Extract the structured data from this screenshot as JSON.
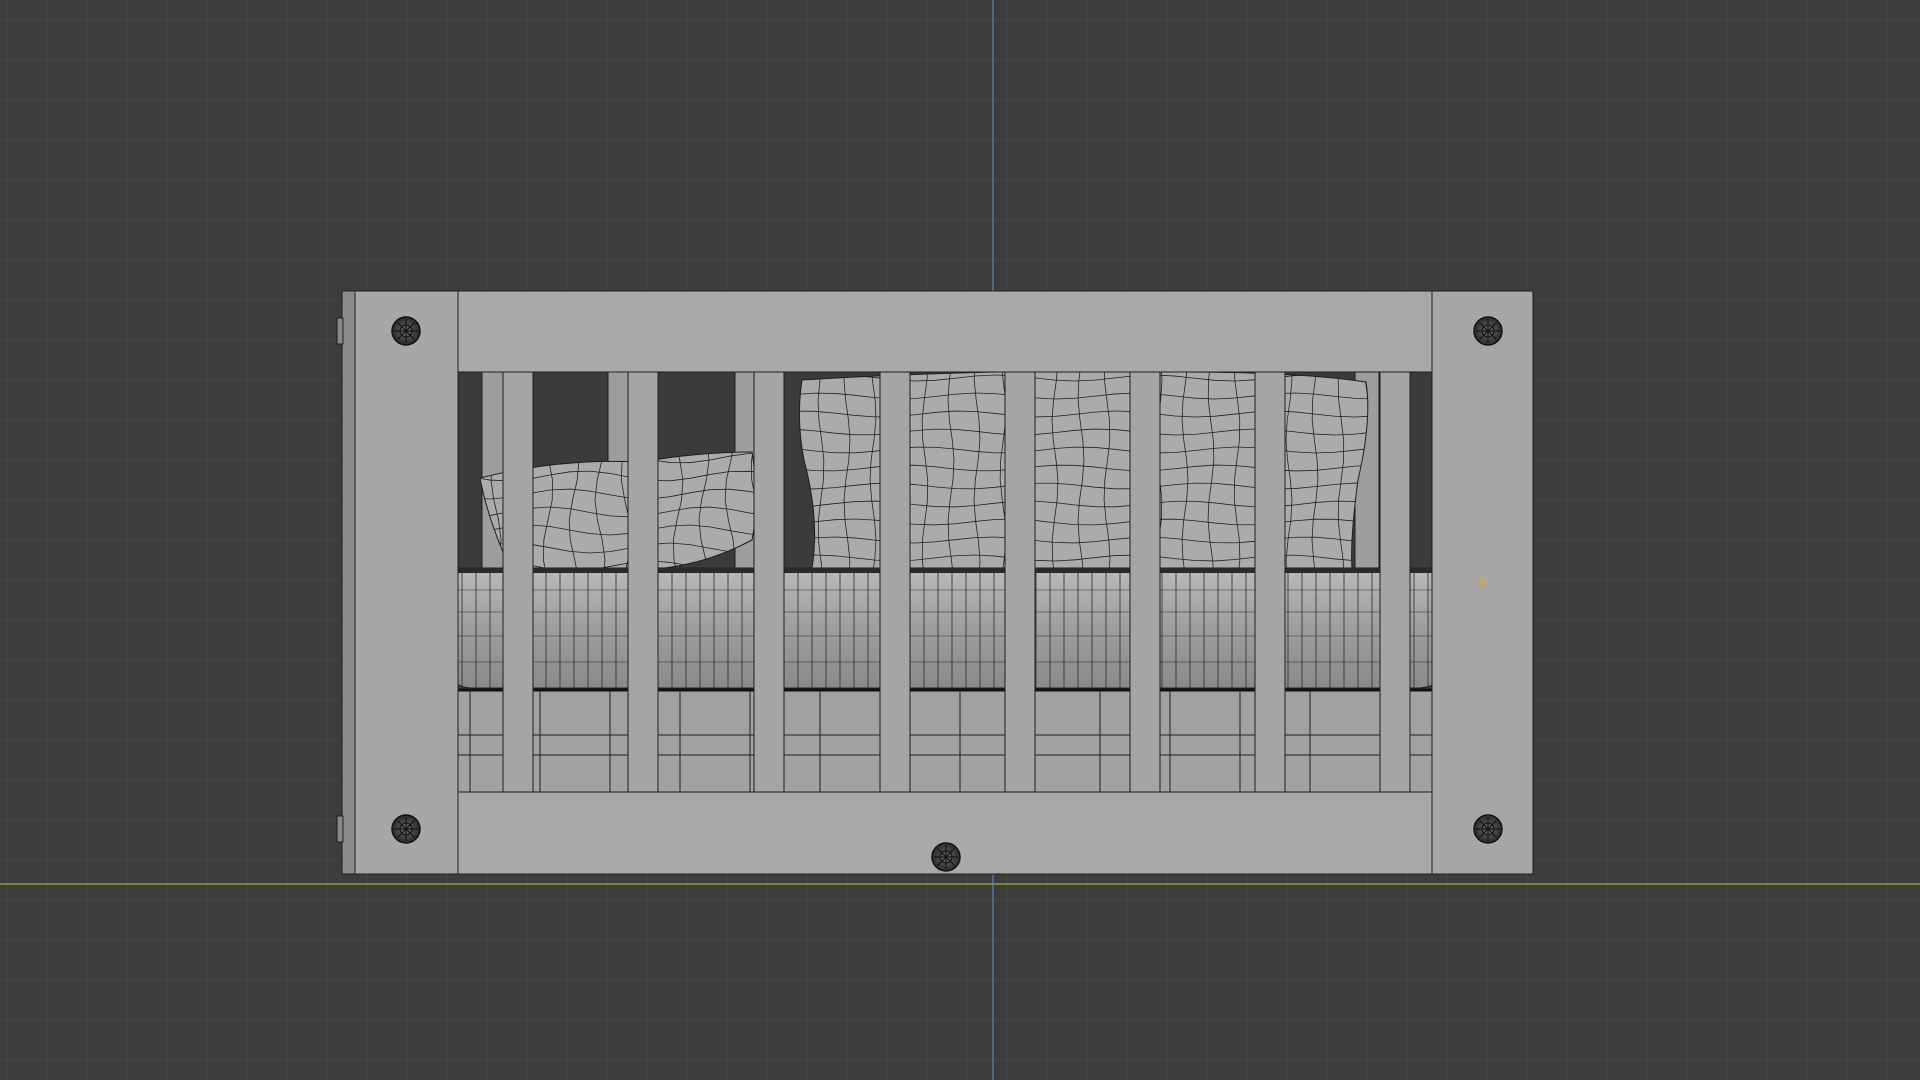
{
  "viewport": {
    "view": "front-orthographic",
    "shading": "solid-wireframe-overlay",
    "grid": true
  },
  "colors": {
    "background": "#3d3d3d",
    "grid_minor": "#474747",
    "axis_x": "#7fa63a",
    "axis_z": "#4a78ad",
    "mesh_fill": "#a9a9a9",
    "mesh_edge": "#1f1f1f",
    "origin_dot": "#e8a517"
  },
  "scene": {
    "objects": [
      {
        "kind": "crib-frame",
        "parts": [
          "top-rail",
          "bottom-rail",
          "left-post",
          "right-post"
        ]
      },
      {
        "kind": "crib-slats",
        "count": 8
      },
      {
        "kind": "mattress"
      },
      {
        "kind": "pillow",
        "count": 2
      },
      {
        "kind": "bolt-head",
        "count": 5
      },
      {
        "kind": "object-origin"
      }
    ]
  },
  "icons": {
    "bolt": "bolt-head-icon",
    "origin": "object-origin-icon"
  }
}
